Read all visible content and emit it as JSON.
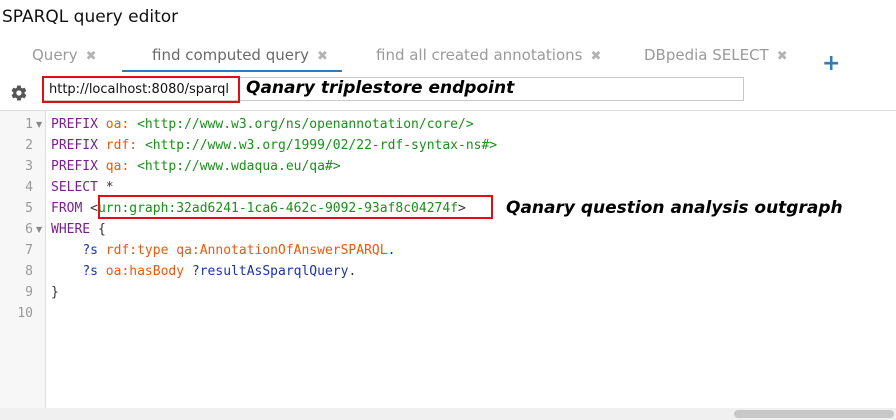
{
  "app": {
    "title": "SPARQL query editor"
  },
  "tabs": [
    {
      "label": "Query",
      "close": "✖",
      "active": false
    },
    {
      "label": "find computed query",
      "close": "✖",
      "active": true
    },
    {
      "label": "find all created annotations",
      "close": "✖",
      "active": false
    },
    {
      "label": "DBpedia SELECT",
      "close": "✖",
      "active": false
    }
  ],
  "add_tab_label": "+",
  "settings_icon": "gear-icon",
  "endpoint": {
    "value": "http://localhost:8080/sparql"
  },
  "annotations": {
    "endpoint": "Qanary triplestore endpoint",
    "outgraph": "Qanary question analysis outgraph"
  },
  "editor": {
    "line_numbers": [
      "1",
      "2",
      "3",
      "4",
      "5",
      "6",
      "7",
      "8",
      "9",
      "10"
    ],
    "lines": {
      "l1": {
        "kw": "PREFIX",
        "prefix": "oa:",
        "iri": "<http://www.w3.org/ns/openannotation/core/>"
      },
      "l2": {
        "kw": "PREFIX",
        "prefix": "rdf:",
        "iri": "<http://www.w3.org/1999/02/22-rdf-syntax-ns#>"
      },
      "l3": {
        "kw": "PREFIX",
        "prefix": "qa:",
        "iri": "<http://www.wdaqua.eu/qa#>"
      },
      "l4": {
        "kw": "SELECT",
        "rest": "*"
      },
      "l5": {
        "kw": "FROM",
        "open": "<",
        "iri": "urn:graph:32ad6241-1ca6-462c-9092-93af8c04274f",
        "close": ">"
      },
      "l6": {
        "kw": "WHERE",
        "rest": "{"
      },
      "l7": {
        "var": "?s",
        "pred": "rdf:type",
        "obj": "qa:AnnotationOfAnswerSPARQL",
        "end": "."
      },
      "l8": {
        "var": "?s",
        "pred": "oa:hasBody",
        "obj": "?resultAsSparqlQuery",
        "end": "."
      },
      "l9": {
        "text": "}"
      }
    }
  },
  "colors": {
    "keyword": "#7a1f8f",
    "prefix": "#e65a10",
    "iri": "#1a8f1a",
    "variable": "#1a34a8",
    "highlight_box": "#e01010",
    "accent": "#337ab7"
  }
}
